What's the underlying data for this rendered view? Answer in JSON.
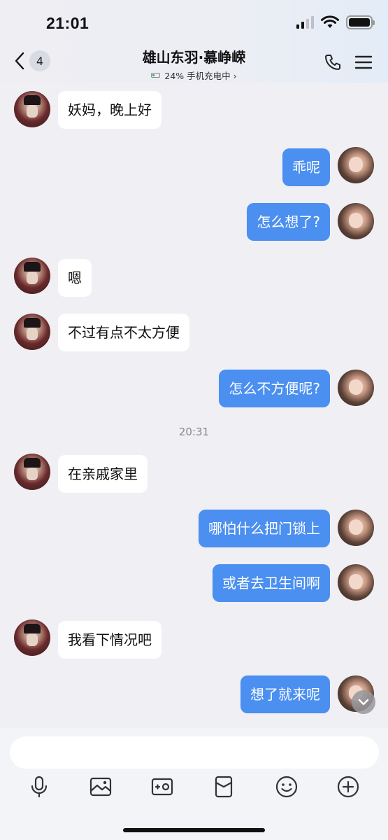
{
  "status": {
    "time": "21:01"
  },
  "header": {
    "unread_count": "4",
    "title": "雄山东羽·慕峥嵘",
    "subtitle": "24% 手机充电中 ›"
  },
  "messages": [
    {
      "side": "left",
      "text": "妖妈，晚上好"
    },
    {
      "side": "right",
      "text": "乖呢"
    },
    {
      "side": "right",
      "text": "怎么想了?"
    },
    {
      "side": "left",
      "text": "嗯"
    },
    {
      "side": "left",
      "text": "不过有点不太方便"
    },
    {
      "side": "right",
      "text": "怎么不方便呢?"
    },
    {
      "timestamp": "20:31"
    },
    {
      "side": "left",
      "text": "在亲戚家里"
    },
    {
      "side": "right",
      "text": "哪怕什么把门锁上"
    },
    {
      "side": "right",
      "text": "或者去卫生间啊"
    },
    {
      "side": "left",
      "text": "我看下情况吧"
    },
    {
      "side": "right",
      "text": "想了就来呢"
    }
  ],
  "composer": {
    "placeholder": ""
  },
  "toolbar_icons": [
    "microphone-icon",
    "image-icon",
    "camera-icon",
    "red-packet-icon",
    "emoji-icon",
    "plus-icon"
  ],
  "colors": {
    "outgoing_bubble": "#4b8ff0",
    "incoming_bubble": "#ffffff",
    "background": "#efeff4"
  }
}
